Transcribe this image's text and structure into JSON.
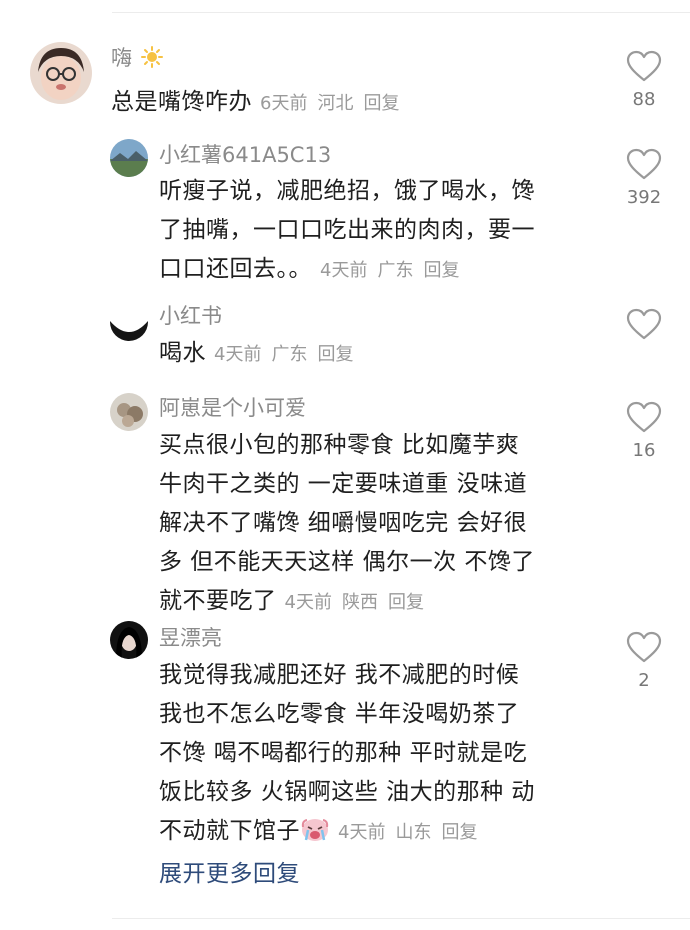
{
  "comments": [
    {
      "username": "嗨",
      "username_icon": "sun-emoji",
      "text": "总是嘴馋咋办",
      "time": "6天前",
      "location": "河北",
      "reply_label": "回复",
      "likes": "88"
    },
    {
      "username": "小红薯641A5C13",
      "text": "听瘦子说，减肥绝招，饿了喝水，馋了抽嘴，一口口吃出来的肉肉，要一口口还回去。。",
      "line1": "听瘦子说，减肥绝招，饿了喝水，馋",
      "line2": "了抽嘴，一口口吃出来的肉肉，要一",
      "line3": "口口还回去。。",
      "time": "4天前",
      "location": "广东",
      "reply_label": "回复",
      "likes": "392"
    },
    {
      "username": "小红书",
      "text": "喝水",
      "time": "4天前",
      "location": "广东",
      "reply_label": "回复",
      "likes": ""
    },
    {
      "username": "阿崽是个小可爱",
      "line1": "买点很小包的那种零食 比如魔芋爽",
      "line2": "牛肉干之类的 一定要味道重 没味道",
      "line3": "解决不了嘴馋 细嚼慢咽吃完 会好很",
      "line4": "多 但不能天天这样 偶尔一次 不馋了",
      "line5": "就不要吃了",
      "time": "4天前",
      "location": "陕西",
      "reply_label": "回复",
      "likes": "16"
    },
    {
      "username": "昱漂亮",
      "line1": "我觉得我减肥还好 我不减肥的时候",
      "line2": "我也不怎么吃零食 半年没喝奶茶了",
      "line3": "不馋 喝不喝都行的那种 平时就是吃",
      "line4": "饭比较多 火锅啊这些 油大的那种 动",
      "line5": "不动就下馆子",
      "trailing_icon": "crying-face-emoji",
      "time": "4天前",
      "location": "山东",
      "reply_label": "回复",
      "likes": "2"
    }
  ],
  "expand_label": "展开更多回复",
  "icons": {
    "like": "heart-outline-icon"
  },
  "colors": {
    "link": "#2e4b7a",
    "meta": "#9a9a9a",
    "username": "#8a8a8a"
  }
}
